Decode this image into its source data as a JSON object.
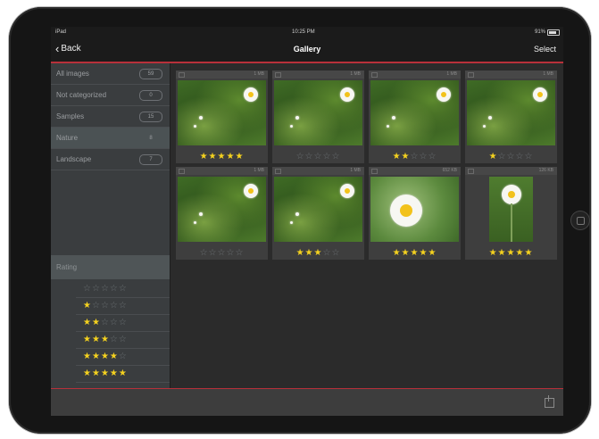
{
  "status": {
    "carrier": "iPad",
    "time": "10:25 PM",
    "battery": "91%"
  },
  "nav": {
    "back_label": "Back",
    "title": "Gallery",
    "select_label": "Select"
  },
  "sidebar": {
    "categories": [
      {
        "label": "All images",
        "count": "59",
        "active": false
      },
      {
        "label": "Not categorized",
        "count": "0",
        "active": false
      },
      {
        "label": "Samples",
        "count": "15",
        "active": false
      },
      {
        "label": "Nature",
        "count": "8",
        "active": true
      },
      {
        "label": "Landscape",
        "count": "7",
        "active": false
      }
    ],
    "rating_header": "Rating",
    "ratings": [
      0,
      1,
      2,
      3,
      4,
      5
    ]
  },
  "gallery": {
    "items": [
      {
        "size": "1 MB",
        "rating": 5,
        "type": "grass"
      },
      {
        "size": "1 MB",
        "rating": 0,
        "type": "grass"
      },
      {
        "size": "1 MB",
        "rating": 2,
        "type": "grass"
      },
      {
        "size": "1 MB",
        "rating": 1,
        "type": "grass"
      },
      {
        "size": "1 MB",
        "rating": 0,
        "type": "grass"
      },
      {
        "size": "1 MB",
        "rating": 3,
        "type": "grass"
      },
      {
        "size": "652 KB",
        "rating": 5,
        "type": "daisy"
      },
      {
        "size": "126 KB",
        "rating": 5,
        "type": "tall"
      }
    ]
  },
  "colors": {
    "accent": "#b8303a",
    "star": "#f5d21f"
  }
}
